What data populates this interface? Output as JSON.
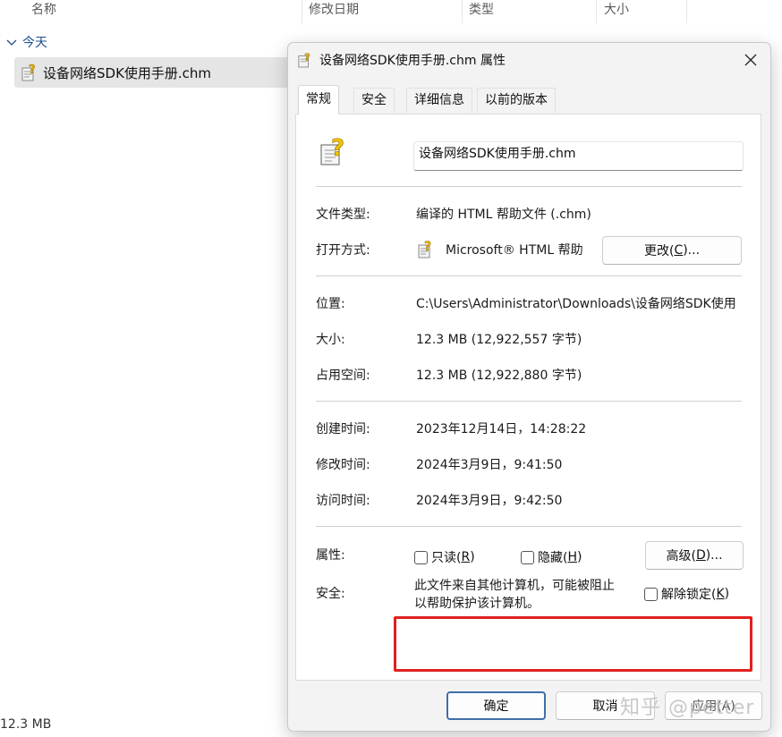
{
  "explorer": {
    "columns": [
      "名称",
      "修改日期",
      "类型",
      "大小"
    ],
    "group_label": "今天",
    "file_name": "设备网络SDK使用手册.chm",
    "status": "12.3 MB"
  },
  "dialog": {
    "title": "设备网络SDK使用手册.chm 属性",
    "tabs": [
      "常规",
      "安全",
      "详细信息",
      "以前的版本"
    ],
    "file_name_value": "设备网络SDK使用手册.chm",
    "file_type_label": "文件类型:",
    "file_type_value": "编译的 HTML 帮助文件 (.chm)",
    "open_with_label": "打开方式:",
    "open_with_value": "Microsoft® HTML 帮助",
    "change_button": {
      "text": "更改(",
      "key": "C",
      "suffix": ")..."
    },
    "location_label": "位置:",
    "location_value": "C:\\Users\\Administrator\\Downloads\\设备网络SDK使用",
    "size_label": "大小:",
    "size_value": "12.3 MB (12,922,557 字节)",
    "disk_size_label": "占用空间:",
    "disk_size_value": "12.3 MB (12,922,880 字节)",
    "created_label": "创建时间:",
    "created_value": "2023年12月14日，14:28:22",
    "modified_label": "修改时间:",
    "modified_value": "2024年3月9日，9:41:50",
    "accessed_label": "访问时间:",
    "accessed_value": "2024年3月9日，9:42:50",
    "attributes_label": "属性:",
    "readonly": {
      "text": "只读(",
      "key": "R",
      "suffix": ")"
    },
    "hidden": {
      "text": "隐藏(",
      "key": "H",
      "suffix": ")"
    },
    "advanced_button": {
      "text": "高级(",
      "key": "D",
      "suffix": ")..."
    },
    "security_label": "安全:",
    "security_text_1": "此文件来自其他计算机，可能被阻止",
    "security_text_2": "以帮助保护该计算机。",
    "unblock": {
      "text": "解除锁定(",
      "key": "K",
      "suffix": ")"
    },
    "ok_button": "确定",
    "cancel_button": "取消",
    "apply_button": "应用(A)"
  },
  "watermark": "知乎 @petter",
  "colors": {
    "highlight_box": "#e02020",
    "ok_border": "#3e6fa8"
  }
}
